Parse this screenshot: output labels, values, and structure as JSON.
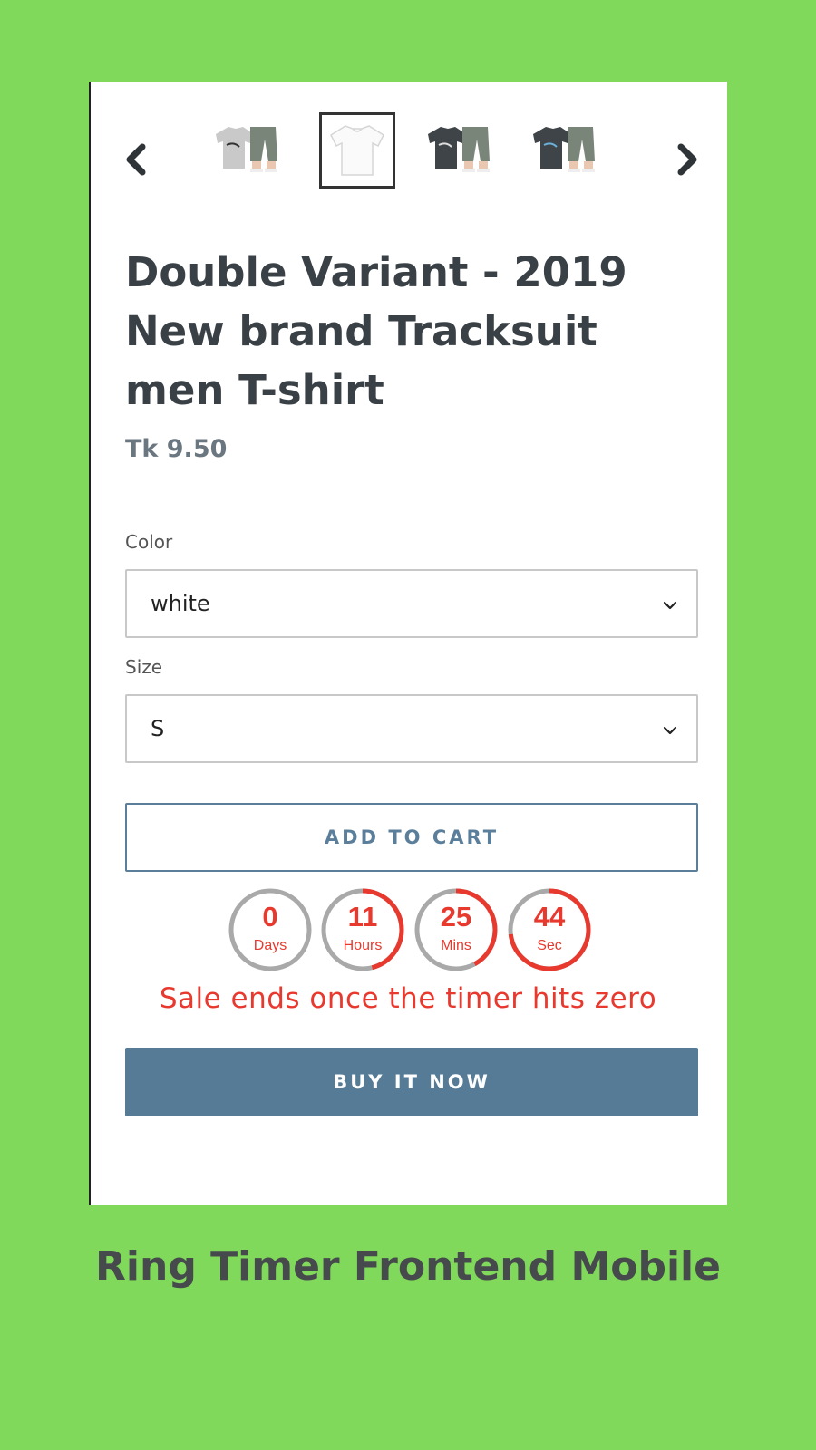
{
  "gallery": {
    "thumbnails": [
      {
        "alt": "grey-tshirt-tracksuit"
      },
      {
        "alt": "white-tshirt"
      },
      {
        "alt": "dark-tshirt-tracksuit"
      },
      {
        "alt": "dark-tshirt-tracksuit-2"
      }
    ],
    "active_index": 1,
    "prev_icon": "chevron-left-icon",
    "next_icon": "chevron-right-icon"
  },
  "product": {
    "title": "Double Variant - 2019 New brand Tracksuit men T-shirt",
    "price": "Tk 9.50"
  },
  "options": {
    "color_label": "Color",
    "color_value": "white",
    "size_label": "Size",
    "size_value": "S"
  },
  "buttons": {
    "add_to_cart": "ADD TO CART",
    "buy_now": "BUY IT NOW"
  },
  "timer": {
    "units": [
      {
        "value": "0",
        "label": "Days",
        "fraction": 0.0
      },
      {
        "value": "11",
        "label": "Hours",
        "fraction": 0.46
      },
      {
        "value": "25",
        "label": "Mins",
        "fraction": 0.42
      },
      {
        "value": "44",
        "label": "Sec",
        "fraction": 0.73
      }
    ],
    "message": "Sale ends once the timer hits zero"
  },
  "caption": "Ring Timer Frontend Mobile",
  "colors": {
    "background": "#80d95a",
    "accent_red": "#e8392f",
    "button_blue": "#557b96",
    "ring_grey": "#a9a9a9"
  }
}
